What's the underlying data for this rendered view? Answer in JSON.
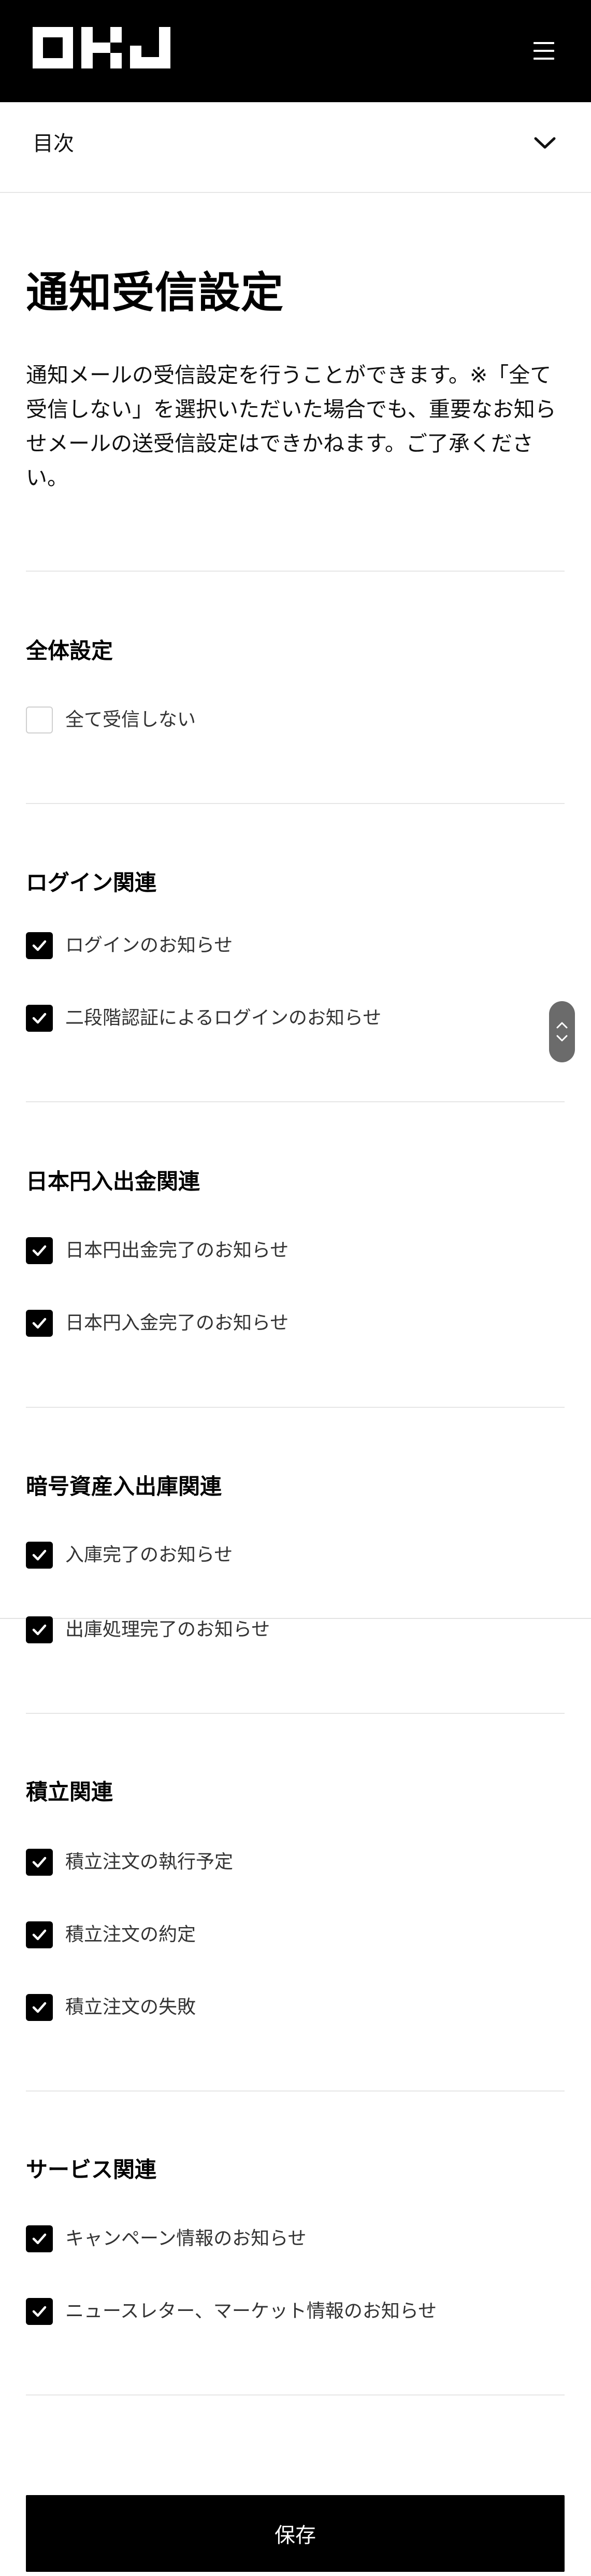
{
  "header": {
    "logo_text": "OKJ",
    "menu_icon": "hamburger-icon"
  },
  "toc": {
    "label": "目次",
    "icon": "chevron-down-icon"
  },
  "page": {
    "title": "通知受信設定",
    "description": "通知メールの受信設定を行うことができます。※「全て受信しない」を選択いただいた場合でも、重要なお知らせメールの送受信設定はできかねます。ご了承ください。"
  },
  "sections": [
    {
      "title": "全体設定",
      "options": [
        {
          "label": "全て受信しない",
          "checked": false
        }
      ]
    },
    {
      "title": "ログイン関連",
      "options": [
        {
          "label": "ログインのお知らせ",
          "checked": true
        },
        {
          "label": "二段階認証によるログインのお知らせ",
          "checked": true
        }
      ]
    },
    {
      "title": "日本円入出金関連",
      "options": [
        {
          "label": "日本円出金完了のお知らせ",
          "checked": true
        },
        {
          "label": "日本円入金完了のお知らせ",
          "checked": true
        }
      ]
    },
    {
      "title": "暗号資産入出庫関連",
      "options": [
        {
          "label": "入庫完了のお知らせ",
          "checked": true
        },
        {
          "label": "出庫処理完了のお知らせ",
          "checked": true
        }
      ]
    },
    {
      "title": "積立関連",
      "options": [
        {
          "label": "積立注文の執行予定",
          "checked": true
        },
        {
          "label": "積立注文の約定",
          "checked": true
        },
        {
          "label": "積立注文の失敗",
          "checked": true
        }
      ]
    },
    {
      "title": "サービス関連",
      "options": [
        {
          "label": "キャンペーン情報のお知らせ",
          "checked": true
        },
        {
          "label": "ニュースレター、マーケット情報のお知らせ",
          "checked": true
        }
      ]
    }
  ],
  "actions": {
    "save_label": "保存"
  },
  "colors": {
    "header_bg": "#000000",
    "checkbox_checked": "#000000",
    "divider": "#e6e6e6",
    "button_bg": "#000000",
    "button_text": "#ffffff"
  }
}
